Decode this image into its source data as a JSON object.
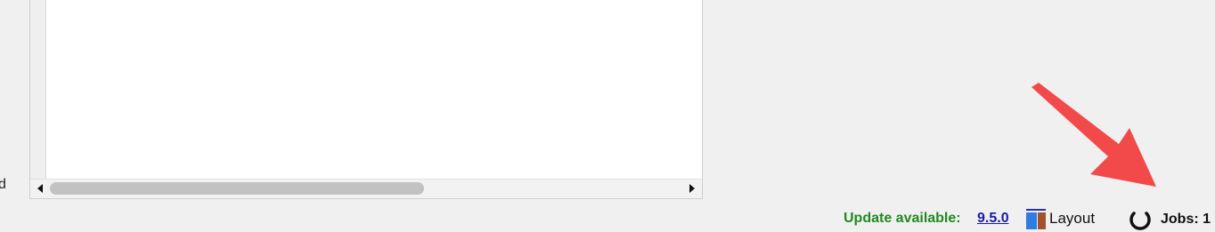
{
  "left_label": "d",
  "panel": {
    "scrollbar": {
      "left_arrow": "scroll-left",
      "right_arrow": "scroll-right",
      "thumb": "horizontal-scroll-thumb"
    }
  },
  "annotation": {
    "icon": "red-arrow-pointer",
    "color": "#f24a4a"
  },
  "status_bar": {
    "update_label": "Update available:",
    "update_version": "9.5.0",
    "layout_label": "Layout",
    "layout_icon": "layout-icon",
    "jobs_icon": "spinner-icon",
    "jobs_label": "Jobs: 1"
  },
  "colors": {
    "update_text": "#1f8a1f",
    "version_link": "#1a1aa8",
    "layout_blue": "#2f7de1",
    "layout_brown": "#a0522d",
    "layout_bar": "#2b2fa8"
  }
}
